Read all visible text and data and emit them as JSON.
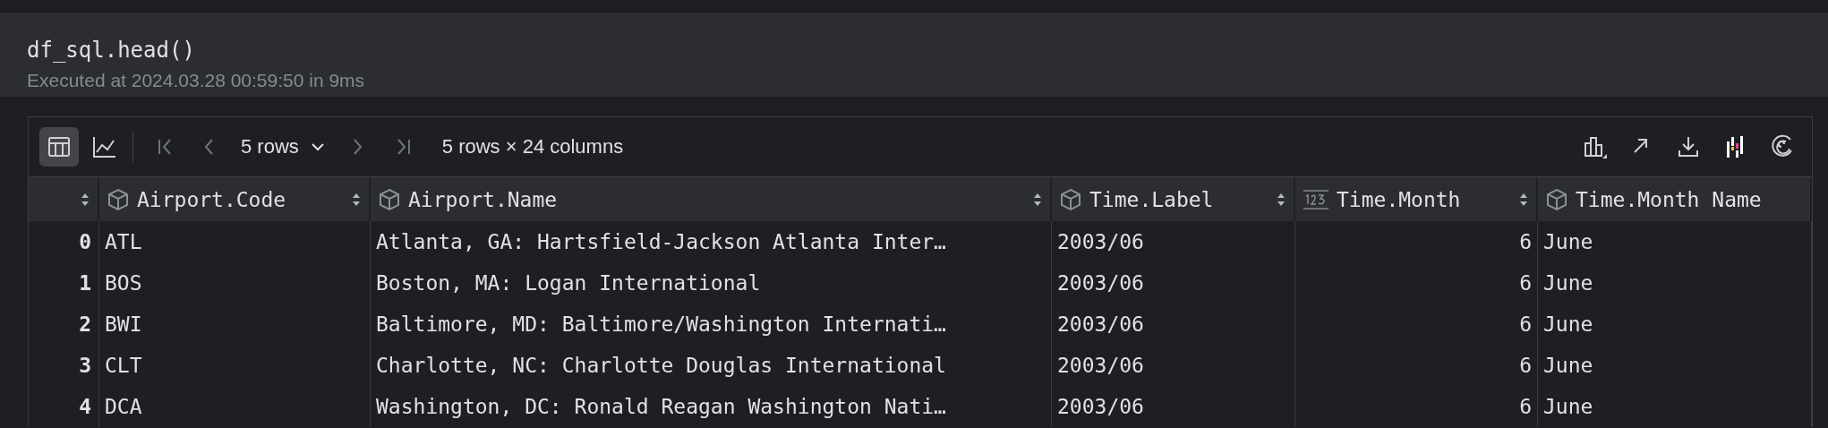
{
  "cell": {
    "code": "df_sql.head()",
    "status": "Executed at 2024.03.28 00:59:50 in 9ms"
  },
  "toolbar": {
    "views": [
      {
        "kind": "table",
        "selected": true
      },
      {
        "kind": "chart",
        "selected": false
      }
    ],
    "navigation": [
      {
        "kind": "first",
        "disabled": true
      },
      {
        "kind": "prev",
        "disabled": true
      },
      {
        "kind": "rows-select",
        "label": "5 rows"
      },
      {
        "kind": "next",
        "disabled": true
      },
      {
        "kind": "last",
        "disabled": true
      }
    ],
    "summary": "5 rows × 24 columns",
    "actions": [
      {
        "kind": "chart"
      },
      {
        "kind": "open"
      },
      {
        "kind": "download"
      },
      {
        "kind": "profile"
      },
      {
        "kind": "swirl"
      }
    ]
  },
  "table": {
    "columns": [
      {
        "kind": "index"
      },
      {
        "name": "Airport.Code",
        "kind": "object"
      },
      {
        "name": "Airport.Name",
        "kind": "object"
      },
      {
        "name": "Time.Label",
        "kind": "object"
      },
      {
        "name": "Time.Month",
        "kind": "number"
      },
      {
        "name": "Time.Month Name",
        "kind": "object"
      }
    ],
    "rows": [
      [
        "0",
        "ATL",
        "Atlanta, GA: Hartsfield-Jackson Atlanta Inter…",
        "2003/06",
        "6",
        "June"
      ],
      [
        "1",
        "BOS",
        "Boston, MA: Logan International",
        "2003/06",
        "6",
        "June"
      ],
      [
        "2",
        "BWI",
        "Baltimore, MD: Baltimore/Washington Internati…",
        "2003/06",
        "6",
        "June"
      ],
      [
        "3",
        "CLT",
        "Charlotte, NC: Charlotte Douglas International",
        "2003/06",
        "6",
        "June"
      ],
      [
        "4",
        "DCA",
        "Washington, DC: Ronald Reagan Washington Nati…",
        "2003/06",
        "6",
        "June"
      ]
    ]
  }
}
